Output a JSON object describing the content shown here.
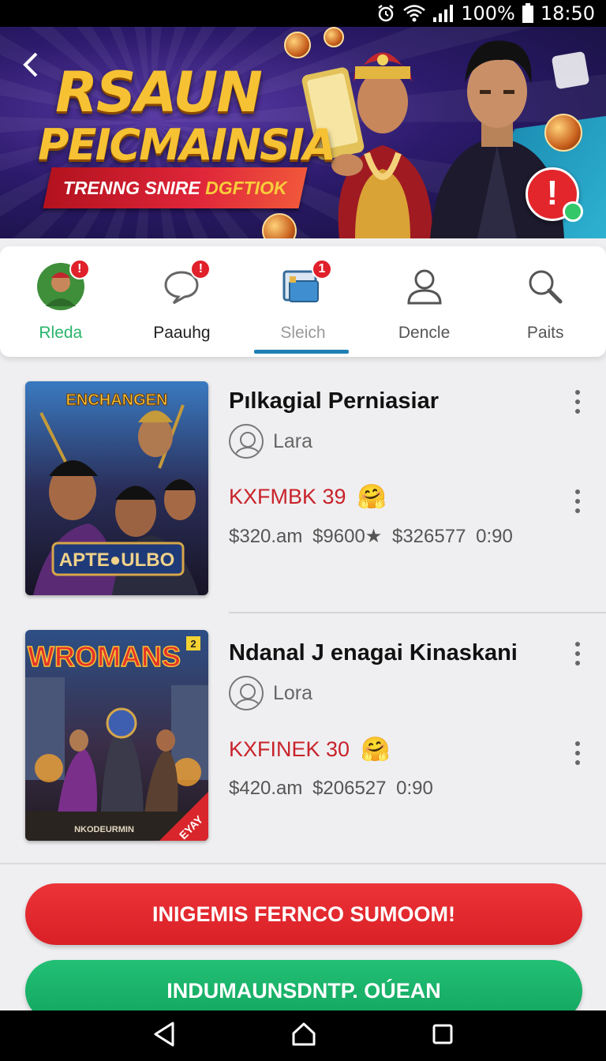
{
  "status_bar": {
    "battery": "100%",
    "time": "18:50"
  },
  "hero": {
    "title": "RSAUN",
    "subtitle": "PEICMAINSIA",
    "ribbon_text": "TRENNG SNIRE",
    "ribbon_highlight": "DGFTIOK",
    "alert_symbol": "!"
  },
  "tabs": [
    {
      "label": "Rleda",
      "icon": "avatar-icon",
      "badge": "!"
    },
    {
      "label": "Paauhg",
      "icon": "chat-bubble-icon",
      "badge": "!"
    },
    {
      "label": "Sleich",
      "icon": "tablet-icon",
      "badge": "1"
    },
    {
      "label": "Dencle",
      "icon": "person-icon"
    },
    {
      "label": "Paits",
      "icon": "search-icon"
    }
  ],
  "items": [
    {
      "title": "Pılkagial Perniasiar",
      "author": "Lara",
      "code": "KXFMBK 39",
      "prices": "$320.am  $9600★  $326577 0:90",
      "cover_top": "ENCHANGEN",
      "cover_bottom": "APTE●ULBO"
    },
    {
      "title": "Ndanal J enagai Kinaskani",
      "author": "Lora",
      "code": "KXFINEK 30",
      "prices": "$420.am  $206527 0:90",
      "cover_top": "WROMANS",
      "cover_bottom": "NKODEURMIN",
      "cover_corner": "EYAY",
      "cover_badge": "2"
    }
  ],
  "buttons": {
    "primary": "INIGEMIS FERNCO SUMOOM!",
    "secondary": "INDUMAUNSDNTP. OÚEAN"
  },
  "colors": {
    "accent_red": "#d92026",
    "accent_green": "#13a55f",
    "tab_underline": "#1f7fb5",
    "code_red": "#c8232a"
  }
}
